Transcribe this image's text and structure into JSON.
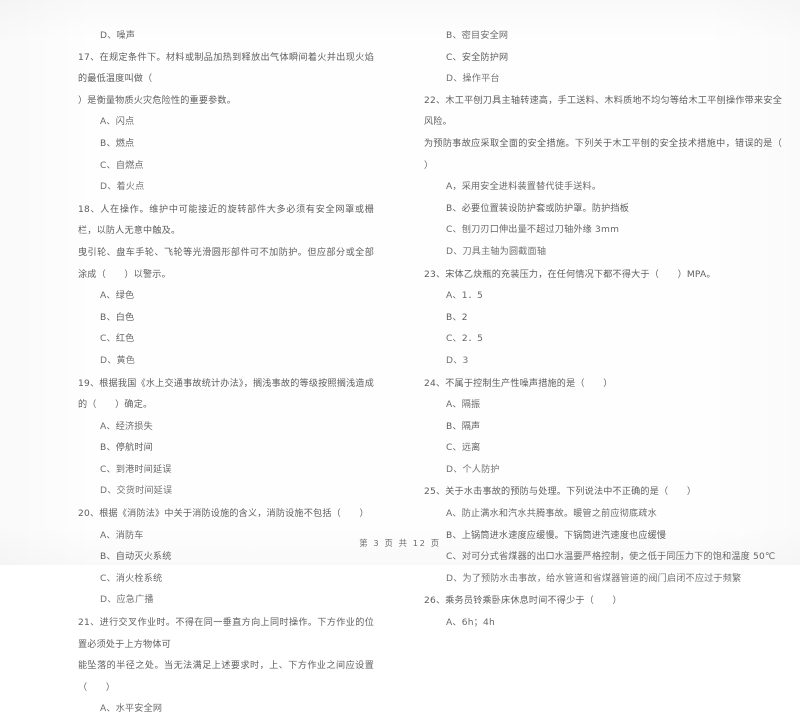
{
  "document": {
    "type": "exam-paper-scan",
    "footer": "第 3 页  共 12 页"
  },
  "left_column": {
    "orphan_option": "D、噪声",
    "questions": [
      {
        "number": "17",
        "text": "17、在规定条件下。材料或制品加热到释放出气体瞬间着火并出现火焰的最低温度叫做（\n）是衡量物质火灾危险性的重要参数。",
        "options": [
          "A、闪点",
          "B、燃点",
          "C、自燃点",
          "D、着火点"
        ]
      },
      {
        "number": "18",
        "text": "18、人在操作。维护中可能接近的旋转部件大多必须有安全网罩或栅栏，以防人无意中触及。\n曳引轮、盘车手轮、飞轮等光滑圆形部件可不加防护。但应部分或全部涂成（      ）以警示。",
        "options": [
          "A、绿色",
          "B、白色",
          "C、红色",
          "D、黄色"
        ]
      },
      {
        "number": "19",
        "text": "19、根据我国《水上交通事故统计办法》，搁浅事故的等级按照搁浅造成的（      ）确定。",
        "options": [
          "A、经济损失",
          "B、停航时间",
          "C、到港时间延误",
          "D、交货时间延误"
        ]
      },
      {
        "number": "20",
        "text": "20、根据《消防法》中关于消防设施的含义，消防设施不包括（      ）",
        "options": [
          "A、消防车",
          "B、自动灭火系统",
          "C、消火栓系统",
          "D、应急广播"
        ]
      },
      {
        "number": "21",
        "text": "21、进行交叉作业时。不得在同一垂直方向上同时操作。下方作业的位置必须处于上方物体可\n能坠落的半径之处。当无法满足上述要求时，上、下方作业之间应设置（      ）",
        "options": [
          "A、水平安全网"
        ]
      }
    ]
  },
  "right_column": {
    "continued_options": [
      "B、密目安全网",
      "C、安全防护网",
      "D、操作平台"
    ],
    "questions": [
      {
        "number": "22",
        "text": "22、木工平刨刀具主轴转速高，手工送料、木料质地不均匀等给木工平刨操作带来安全风险。\n为预防事故应采取全面的安全措施。下列关于木工平刨的安全技术措施中，错误的是（      ）",
        "options": [
          "A，采用安全进料装置替代徒手送料。",
          "B、必要位置装设防护套或防护罩。防护挡板",
          "C、刨刀刃口伸出量不超过刀轴外缘 3mm",
          "D、刀具主轴为圆截面轴"
        ]
      },
      {
        "number": "23",
        "text": "23、宋体乙炔瓶的充装压力，在任何情况下都不得大于（      ）MPA。",
        "options": [
          "A、1．5",
          "B、2",
          "C、2．5",
          "D、3"
        ]
      },
      {
        "number": "24",
        "text": "24、不属于控制生产性噪声措施的是（      ）",
        "options": [
          "A、隔振",
          "B、隔声",
          "C、远离",
          "D、个人防护"
        ]
      },
      {
        "number": "25",
        "text": "25、关于水击事故的预防与处理。下列说法中不正确的是（      ）",
        "options": [
          "A、防止满水和汽水共腾事故。暖管之前应彻底疏水",
          "B、上锅筒进水速度应缓慢。下锅筒进汽速度也应缓慢",
          "C、对可分式省煤器的出口水温要严格控制，使之低于同压力下的饱和温度 50℃",
          "D、为了预防水击事故，给水管道和省煤器管道的阀门启闭不应过于频繁"
        ]
      },
      {
        "number": "26",
        "text": "26、乘务员铃乘卧床休息时间不得少于（      ）",
        "options": [
          "A、6h；4h"
        ]
      }
    ]
  }
}
